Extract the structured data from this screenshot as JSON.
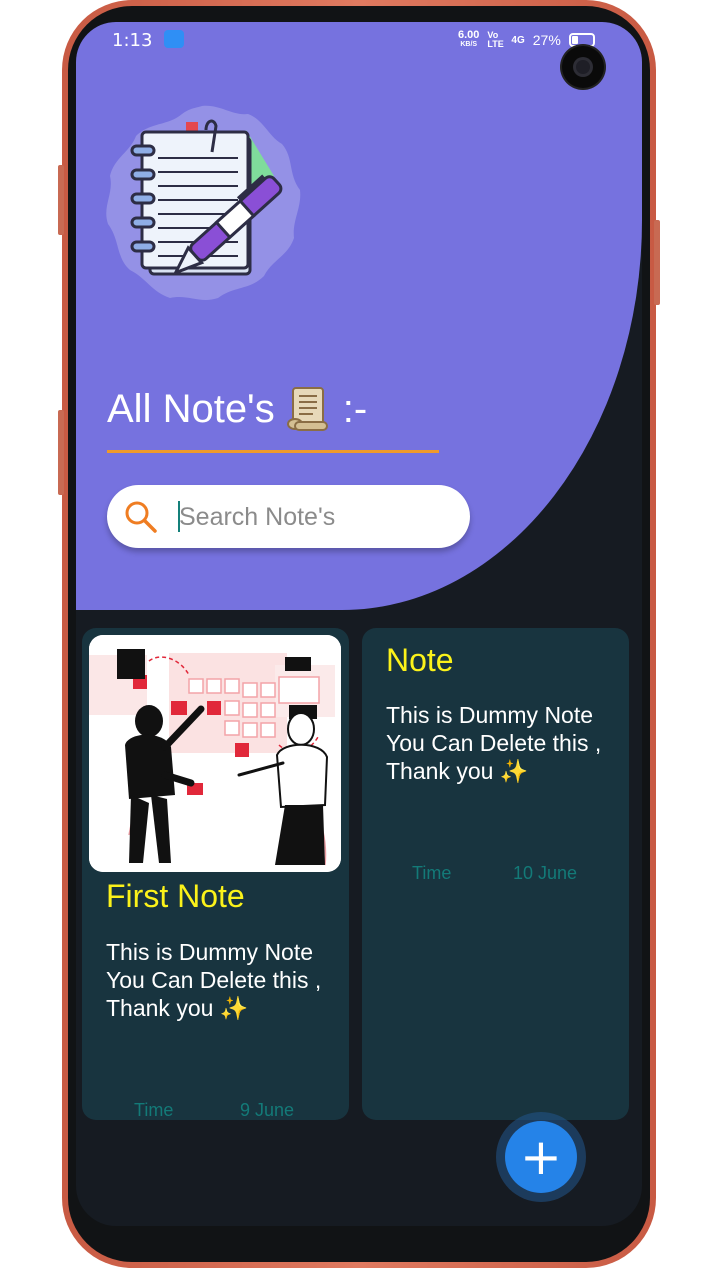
{
  "status_bar": {
    "time": "1:13",
    "speed_value": "6.00",
    "speed_unit": "KB/S",
    "volte": "Vo LTE",
    "signal": "4G",
    "battery": "27%"
  },
  "header": {
    "title": "All Note's",
    "title_suffix": ":-",
    "logo_icon": "notebook-with-pen",
    "title_icon": "scroll"
  },
  "search": {
    "placeholder": "Search Note's",
    "value": "",
    "icon": "search"
  },
  "notes": [
    {
      "title": "First Note",
      "body": "This is Dummy Note You Can Delete this  , Thank you ✨",
      "time_label": "Time",
      "date": "9 June",
      "has_image": true
    },
    {
      "title": "Note",
      "body": "This is Dummy Note You Can Delete this  , Thank you ✨",
      "time_label": "Time",
      "date": "10 June",
      "has_image": false
    }
  ],
  "fab": {
    "label": "+",
    "icon": "plus"
  },
  "colors": {
    "header_bg": "#7672df",
    "app_bg": "#161b22",
    "card_bg": "#18343f",
    "note_title": "#fbf21a",
    "meta_text": "#137a78",
    "accent_line": "#f09a2a",
    "fab": "#2583e8"
  }
}
